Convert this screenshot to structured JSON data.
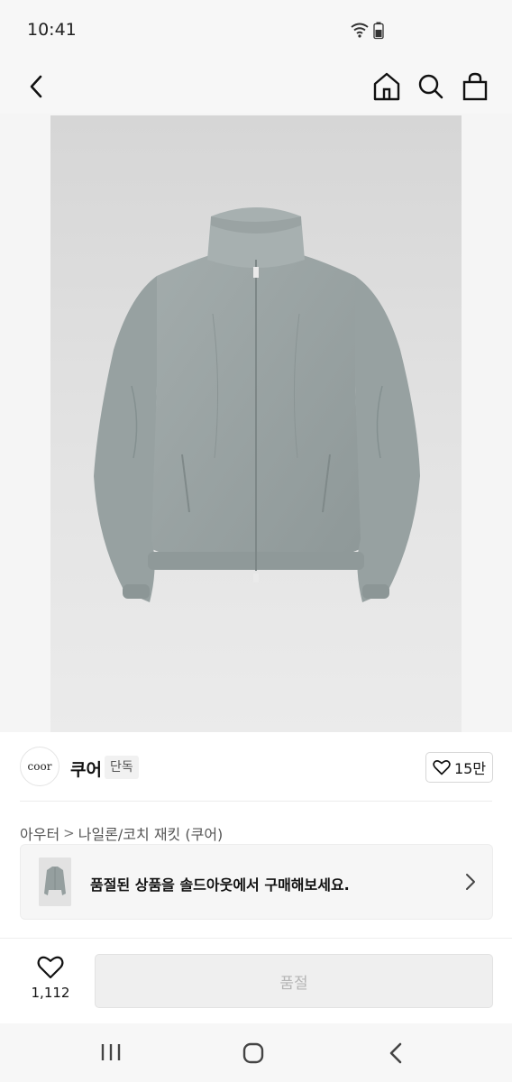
{
  "status_bar": {
    "time": "10:41"
  },
  "brand": {
    "logo_text": "coor",
    "name": "쿠어",
    "badge": "단독",
    "like_count": "15만"
  },
  "breadcrumb": {
    "items": [
      "아우터",
      "나일론/코치 재킷 (쿠어)"
    ],
    "separator": ">"
  },
  "soldout_banner": {
    "text": "품절된 상품을 솔드아웃에서 구매해보세요."
  },
  "bottom_bar": {
    "wish_count": "1,112",
    "buy_button_label": "품절"
  },
  "colors": {
    "accent_disabled": "#efefef",
    "jacket": "#98a2a2",
    "background": "#f7f7f7"
  }
}
